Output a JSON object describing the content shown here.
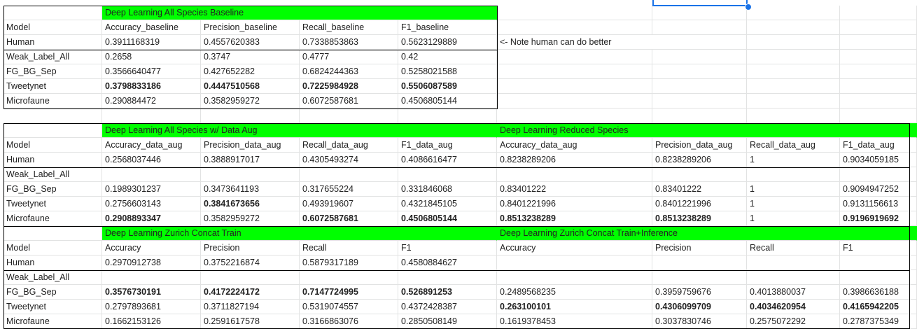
{
  "selection_color": "#1a73e8",
  "header_color": "#00ff00",
  "tables": [
    {
      "title": "Deep Learning All Species Baseline",
      "columns": [
        "Model",
        "Accuracy_baseline",
        "Precision_baseline",
        "Recall_baseline",
        "F1_baseline"
      ],
      "rows": [
        {
          "model": "Human",
          "values": [
            "0.3911168319",
            "0.4557620383",
            "0.7338853863",
            "0.5623129889"
          ],
          "note": "<- Note human can do better"
        },
        {
          "model": "Weak_Label_All",
          "values": [
            "0.2658",
            "0.3747",
            "0.4777",
            "0.42"
          ]
        },
        {
          "model": "FG_BG_Sep",
          "values": [
            "0.3566640477",
            "0.427652282",
            "0.6824244363",
            "0.5258021588"
          ]
        },
        {
          "model": "Tweetynet",
          "values": [
            "0.3798833186",
            "0.4447510568",
            "0.7225984928",
            "0.5506087589"
          ],
          "bold": [
            true,
            true,
            true,
            true
          ]
        },
        {
          "model": "Microfaune",
          "values": [
            "0.290884472",
            "0.3582959272",
            "0.6072587681",
            "0.4506805144"
          ]
        }
      ]
    },
    {
      "title": "Deep Learning All Species w/ Data Aug",
      "columns": [
        "Model",
        "Accuracy_data_aug",
        "Precision_data_aug",
        "Recall_data_aug",
        "F1_data_aug"
      ],
      "rows": [
        {
          "model": "Human",
          "values": [
            "0.2568037446",
            "0.3888917017",
            "0.4305493274",
            "0.4086616477"
          ]
        },
        {
          "model": "Weak_Label_All",
          "values": [
            "",
            "",
            "",
            ""
          ]
        },
        {
          "model": "FG_BG_Sep",
          "values": [
            "0.1989301237",
            "0.3473641193",
            "0.317655224",
            "0.331846068"
          ]
        },
        {
          "model": "Tweetynet",
          "values": [
            "0.2756603143",
            "0.3841673656",
            "0.493919607",
            "0.4321845105"
          ],
          "bold": [
            false,
            true,
            false,
            false
          ]
        },
        {
          "model": "Microfaune",
          "values": [
            "0.2908893347",
            "0.3582959272",
            "0.6072587681",
            "0.4506805144"
          ],
          "bold": [
            true,
            false,
            true,
            true
          ]
        }
      ]
    },
    {
      "title": "Deep Learning Reduced Species",
      "columns": [
        "Accuracy_data_aug",
        "Precision_data_aug",
        "Recall_data_aug",
        "F1_data_aug"
      ],
      "rows": [
        {
          "values": [
            "0.8238289206",
            "0.8238289206",
            "1",
            "0.9034059185"
          ]
        },
        {
          "values": [
            "",
            "",
            "",
            ""
          ]
        },
        {
          "values": [
            "0.83401222",
            "0.83401222",
            "1",
            "0.9094947252"
          ]
        },
        {
          "values": [
            "0.8401221996",
            "0.8401221996",
            "1",
            "0.9131156613"
          ]
        },
        {
          "values": [
            "0.8513238289",
            "0.8513238289",
            "1",
            "0.9196919692"
          ],
          "bold": [
            true,
            true,
            false,
            true
          ]
        }
      ]
    },
    {
      "title": "Deep Learning Zurich Concat Train",
      "columns": [
        "Model",
        "Accuracy",
        "Precision",
        "Recall",
        "F1"
      ],
      "rows": [
        {
          "model": "Human",
          "values": [
            "0.2970912738",
            "0.3752216874",
            "0.5879317189",
            "0.4580884627"
          ]
        },
        {
          "model": "Weak_Label_All",
          "values": [
            "",
            "",
            "",
            ""
          ]
        },
        {
          "model": "FG_BG_Sep",
          "values": [
            "0.3576730191",
            "0.4172224172",
            "0.7147724995",
            "0.526891253"
          ],
          "bold": [
            true,
            true,
            true,
            true
          ]
        },
        {
          "model": "Tweetynet",
          "values": [
            "0.2797893681",
            "0.3711827194",
            "0.5319074557",
            "0.4372428387"
          ]
        },
        {
          "model": "Microfaune",
          "values": [
            "0.1662153126",
            "0.2591617578",
            "0.3166863076",
            "0.2850508149"
          ]
        }
      ]
    },
    {
      "title": "Deep Learning Zurich Concat Train+Inference",
      "columns": [
        "Accuracy",
        "Precision",
        "Recall",
        "F1"
      ],
      "rows": [
        {
          "values": [
            "",
            "",
            "",
            ""
          ]
        },
        {
          "values": [
            "",
            "",
            "",
            ""
          ]
        },
        {
          "values": [
            "0.2489568235",
            "0.3959759676",
            "0.4013880037",
            "0.3986636188"
          ]
        },
        {
          "values": [
            "0.263100101",
            "0.4306099709",
            "0.4034620954",
            "0.4165942205"
          ],
          "bold": [
            true,
            true,
            true,
            true
          ]
        },
        {
          "values": [
            "0.1619378453",
            "0.3037830746",
            "0.2575072292",
            "0.2787375349"
          ]
        }
      ]
    }
  ]
}
